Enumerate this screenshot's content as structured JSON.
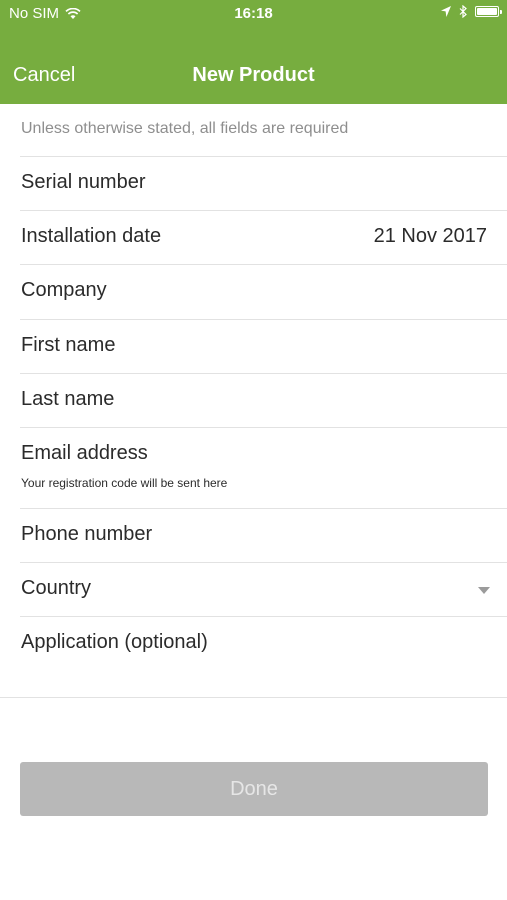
{
  "status_bar": {
    "carrier": "No SIM",
    "time": "16:18",
    "icons": [
      "wifi-icon",
      "location-arrow-icon",
      "bluetooth-icon",
      "battery-icon"
    ]
  },
  "nav": {
    "cancel_label": "Cancel",
    "title": "New Product"
  },
  "form": {
    "notice": "Unless otherwise stated, all fields are required",
    "fields": [
      {
        "label": "Serial number",
        "value": ""
      },
      {
        "label": "Installation date",
        "value": "21 Nov 2017"
      },
      {
        "label": "Company",
        "value": ""
      },
      {
        "label": "First name",
        "value": ""
      },
      {
        "label": "Last name",
        "value": ""
      },
      {
        "label": "Email address",
        "value": "",
        "hint": "Your registration code will be sent here"
      },
      {
        "label": "Phone number",
        "value": ""
      },
      {
        "label": "Country",
        "value": "",
        "icon": "chevron-down-icon"
      },
      {
        "label": "Application (optional)",
        "value": ""
      }
    ]
  },
  "done_label": "Done",
  "colors": {
    "header": "#77ad3f",
    "done_disabled": "#b8b8b8",
    "notice_text": "#8e8e8e"
  }
}
